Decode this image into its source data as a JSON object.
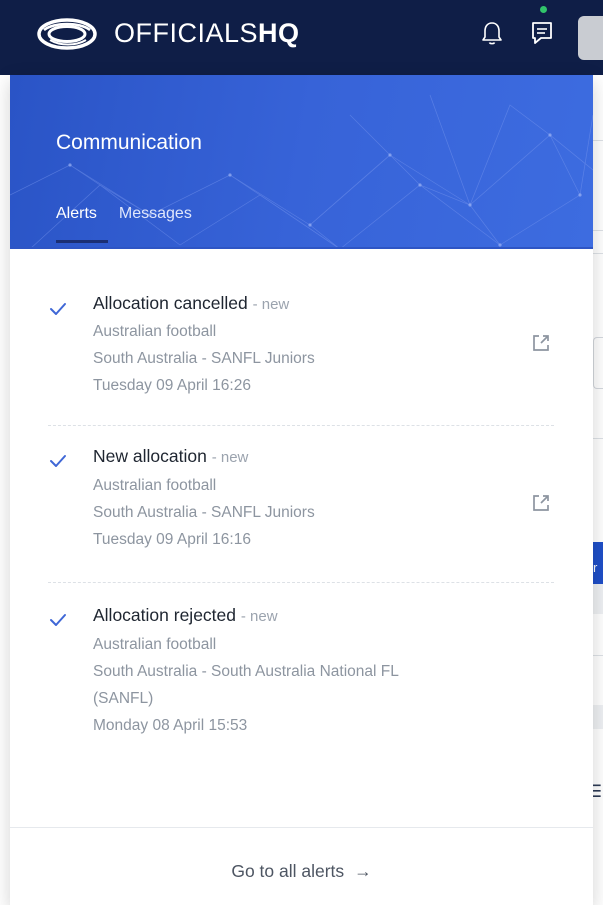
{
  "app": {
    "brand_light": "OFFICIALS",
    "brand_bold": "HQ",
    "topbar_color": "#0f1e47",
    "icons": [
      "logo-icon",
      "bell-icon",
      "chat-icon",
      "avatar"
    ]
  },
  "panel": {
    "title": "Communication",
    "tabs": [
      {
        "label": "Alerts",
        "active": true
      },
      {
        "label": "Messages",
        "active": false
      }
    ],
    "accent": "#2f5bd1"
  },
  "alerts": [
    {
      "title": "Allocation cancelled",
      "badge": "- new",
      "sport": "Australian football",
      "competition": "South Australia - SANFL Juniors",
      "competition_cont": "",
      "datetime": "Tuesday 09 April 16:26",
      "has_link": true
    },
    {
      "title": "New allocation",
      "badge": "- new",
      "sport": "Australian football",
      "competition": "South Australia - SANFL Juniors",
      "competition_cont": "",
      "datetime": "Tuesday 09 April 16:16",
      "has_link": true
    },
    {
      "title": "Allocation rejected",
      "badge": "- new",
      "sport": "Australian football",
      "competition": "South Australia - South Australia National FL",
      "competition_cont": "(SANFL)",
      "datetime": "Monday 08 April 15:53",
      "has_link": false
    }
  ],
  "footer": {
    "link_label": "Go to all alerts",
    "arrow": "→"
  },
  "background": {
    "button_fragment": "r"
  }
}
